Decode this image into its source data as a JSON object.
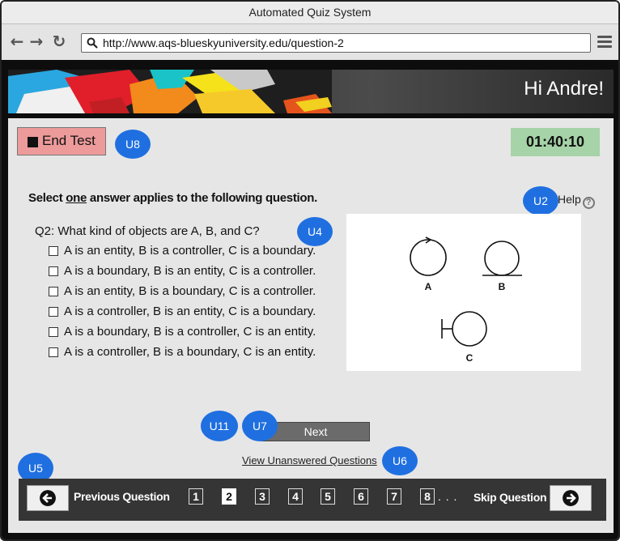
{
  "window": {
    "title": "Automated Quiz System",
    "url": "http://www.aqs-blueskyuniversity.edu/question-2"
  },
  "banner": {
    "greeting": "Hi Andre!"
  },
  "controls": {
    "end_test_label": "End Test",
    "timer": "01:40:10",
    "help_label": "Help",
    "help_glyph": "?"
  },
  "instructions": {
    "prefix": "Select ",
    "emphasis": "one",
    "suffix": " answer applies to the following question."
  },
  "question": {
    "text": "Q2: What kind of objects are A, B, and C?",
    "answers": [
      "A is an entity, B is a controller, C is a boundary.",
      "A is a boundary, B is an entity, C is a controller.",
      "A is an entity, B is a boundary, C is a controller.",
      "A is a controller, B is an entity, C is a boundary.",
      "A is a boundary, B is a controller, C is an entity.",
      "A is a controller, B is a boundary, C is an entity."
    ]
  },
  "diagram": {
    "labels": {
      "a": "A",
      "b": "B",
      "c": "C"
    }
  },
  "annotations": {
    "u8": "U8",
    "u2": "U2",
    "u4": "U4",
    "u11": "U11",
    "u7": "U7",
    "u5": "U5",
    "u6": "U6"
  },
  "next_label": "Next",
  "view_unanswered_label": "View Unanswered Questions",
  "pagination": {
    "previous_label": "Previous Question",
    "skip_label": "Skip Question",
    "pages": [
      "1",
      "2",
      "3",
      "4",
      "5",
      "6",
      "7",
      "8"
    ],
    "current_page": "2",
    "ellipsis": ". . ."
  },
  "colors": {
    "end_test_bg": "#ec9a9a",
    "timer_bg": "#a6d3a8",
    "annotation_badge": "#1f6fe0",
    "nav_bar_bg": "#353535"
  },
  "icons": {
    "back": "left-arrow-icon",
    "forward": "right-arrow-icon",
    "reload": "reload-icon",
    "search": "search-icon",
    "menu": "hamburger-menu-icon",
    "end_test": "stop-square-icon",
    "help": "help-circle-icon",
    "previous": "circle-arrow-left-icon",
    "skip": "circle-arrow-right-icon"
  }
}
